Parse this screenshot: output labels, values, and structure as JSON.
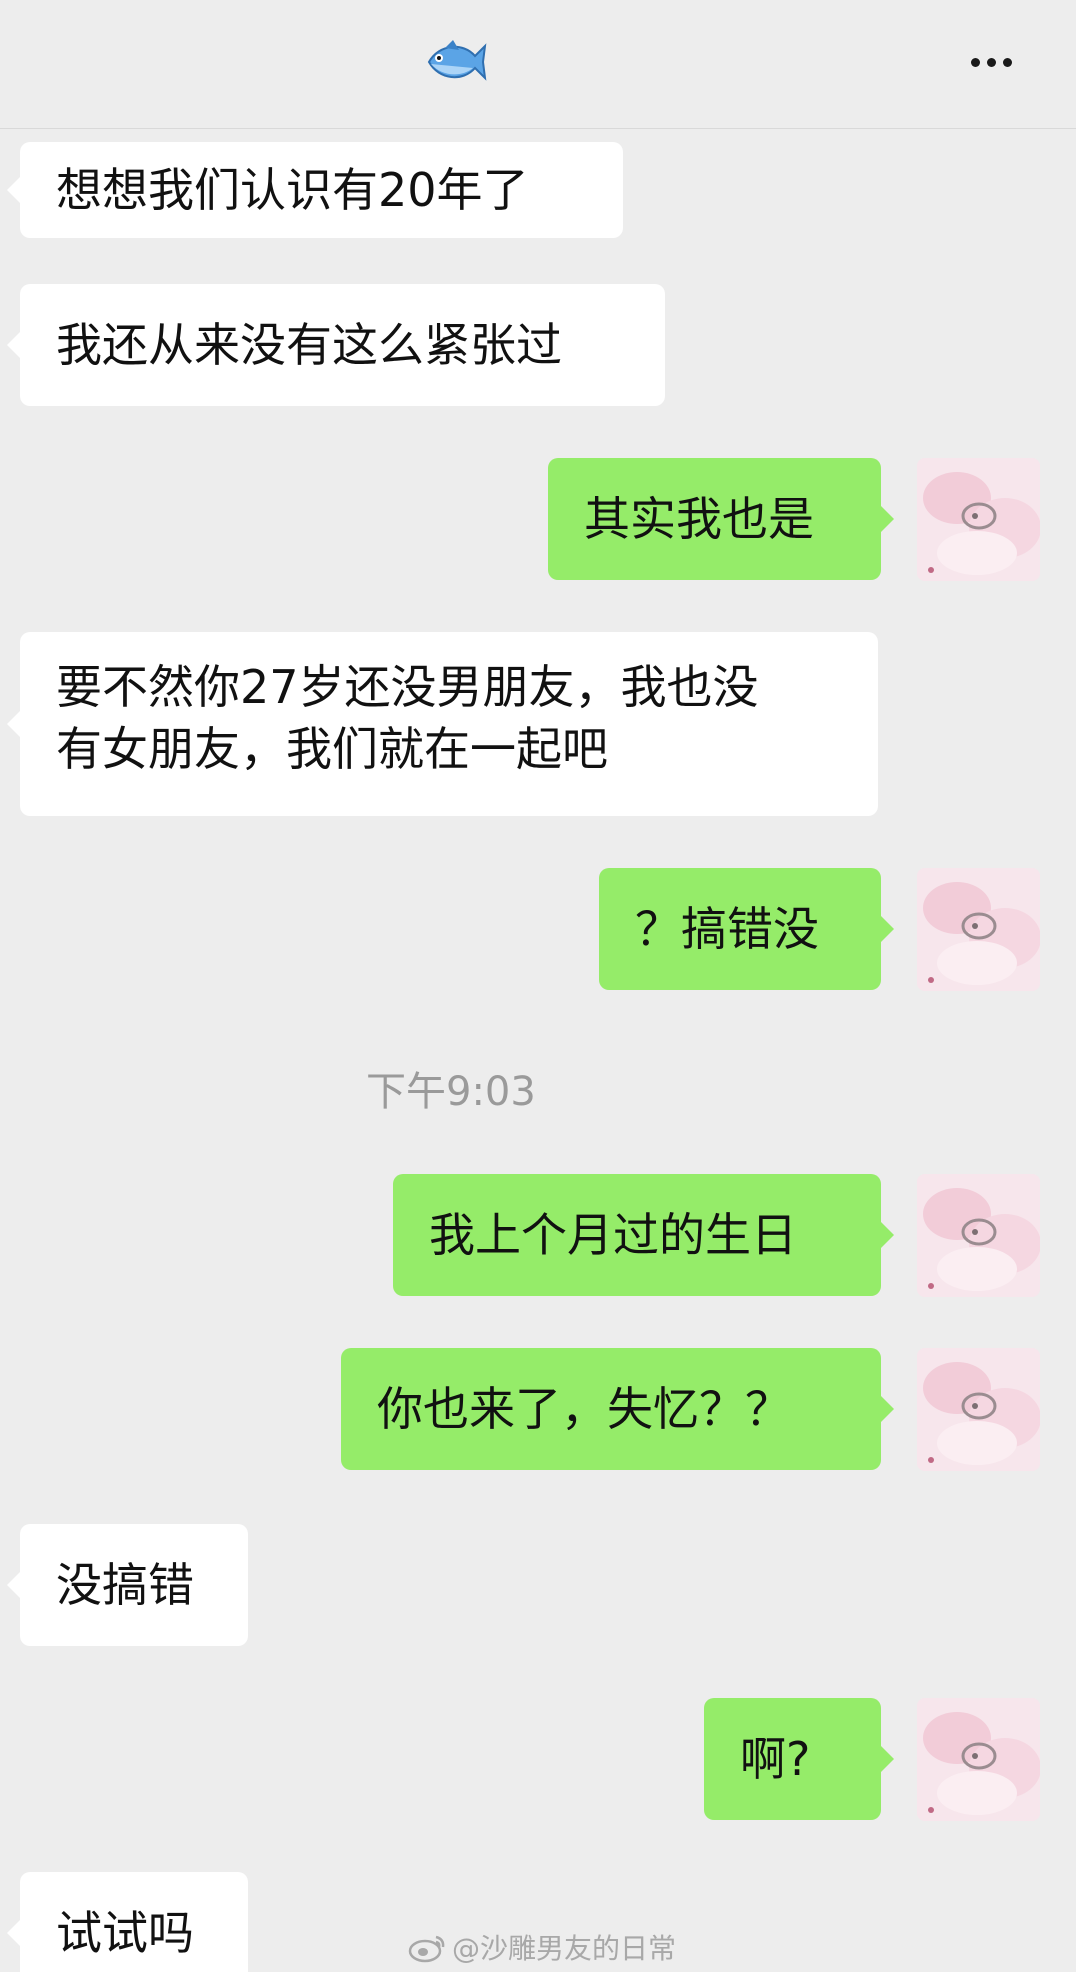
{
  "header": {
    "title_icon": "fish-emoji",
    "more_icon": "more-dots-icon"
  },
  "messages": [
    {
      "side": "in",
      "text": "想想我们认识有20年了"
    },
    {
      "side": "in",
      "text": "我还从来没有这么紧张过"
    },
    {
      "side": "out",
      "text": "其实我也是"
    },
    {
      "side": "in",
      "text": "要不然你27岁还没男朋友，我也没\n有女朋友，我们就在一起吧"
    },
    {
      "side": "out",
      "text": "？搞错没"
    },
    {
      "side": "out",
      "text": "我上个月过的生日"
    },
    {
      "side": "out",
      "text": "你也来了，失忆？？"
    },
    {
      "side": "in",
      "text": "没搞错"
    },
    {
      "side": "out",
      "text": "啊?"
    },
    {
      "side": "in",
      "text": "试试吗"
    }
  ],
  "timestamp": "下午9:03",
  "watermark": {
    "icon": "weibo-icon",
    "text": "@沙雕男友的日常"
  },
  "colors": {
    "background": "#ededed",
    "incoming_bubble": "#ffffff",
    "outgoing_bubble": "#95ec69"
  }
}
